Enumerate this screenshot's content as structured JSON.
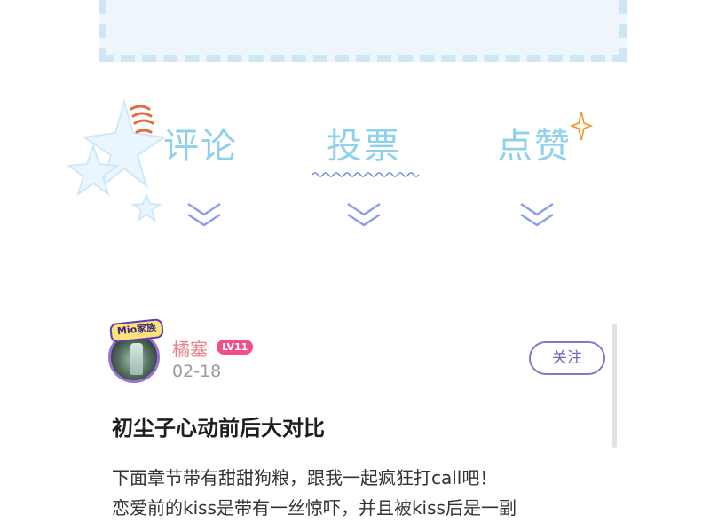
{
  "tabs": {
    "comment_label": "评论",
    "vote_label": "投票",
    "like_label": "点赞"
  },
  "post": {
    "family_badge": "Mio家族",
    "username": "橘塞",
    "level": "LV11",
    "date": "02-18",
    "follow_label": "关注",
    "title": "初尘子心动前后大对比",
    "body_line1": "下面章节带有甜甜狗粮，跟我一起疯狂打call吧！",
    "body_line2": "恋爱前的kiss是带有一丝惊吓，并且被kiss后是一副"
  },
  "colors": {
    "tab_text": "#8fd0ea",
    "chevron": "#8a9fe6",
    "accent_purple": "#8a76c7",
    "level_badge": "#f24e8e",
    "username": "#e8838c"
  }
}
